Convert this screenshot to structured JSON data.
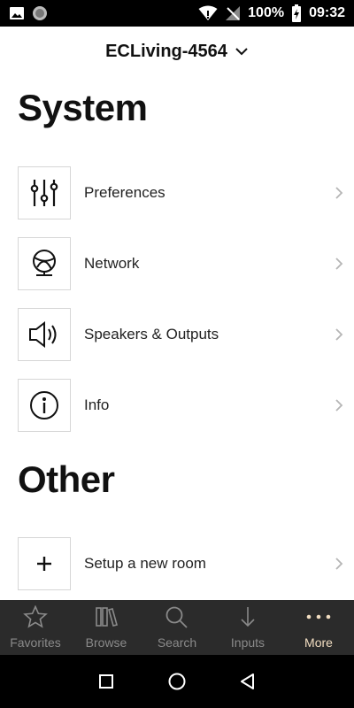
{
  "status_bar": {
    "battery": "100%",
    "time": "09:32"
  },
  "header": {
    "device_name": "ECLiving-4564"
  },
  "sections": {
    "system_title": "System",
    "other_title": "Other"
  },
  "menu": {
    "items": [
      {
        "label": "Preferences",
        "icon": "sliders-icon"
      },
      {
        "label": "Network",
        "icon": "globe-icon"
      },
      {
        "label": "Speakers & Outputs",
        "icon": "speaker-icon"
      },
      {
        "label": "Info",
        "icon": "info-icon"
      },
      {
        "label": "Setup a new room",
        "icon": "plus-icon"
      }
    ]
  },
  "bottom_nav": {
    "items": [
      {
        "label": "Favorites",
        "icon": "star-icon"
      },
      {
        "label": "Browse",
        "icon": "library-icon"
      },
      {
        "label": "Search",
        "icon": "search-icon"
      },
      {
        "label": "Inputs",
        "icon": "arrow-down-icon"
      },
      {
        "label": "More",
        "icon": "more-dots-icon"
      }
    ],
    "active": "More"
  },
  "colors": {
    "nav_background": "#2b2b2b",
    "nav_inactive": "#8a8a8a",
    "nav_active": "#f0dcc0"
  }
}
